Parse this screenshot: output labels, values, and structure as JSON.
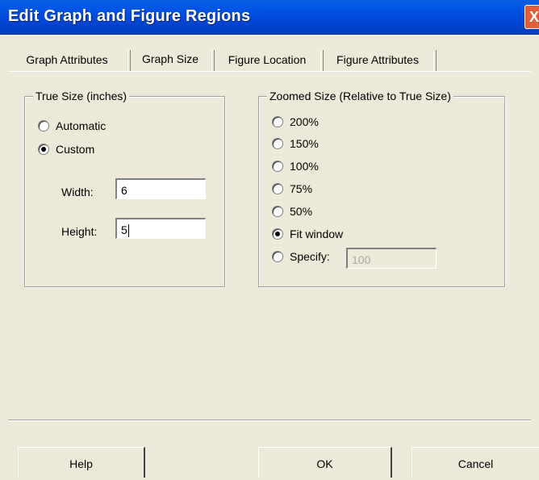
{
  "window": {
    "title": "Edit Graph and Figure Regions",
    "close_glyph": "X"
  },
  "tabs": [
    {
      "label": "Graph Attributes",
      "active": false
    },
    {
      "label": "Graph Size",
      "active": true
    },
    {
      "label": "Figure Location",
      "active": false
    },
    {
      "label": "Figure Attributes",
      "active": false
    }
  ],
  "true_size": {
    "title": "True Size (inches)",
    "options": [
      {
        "label": "Automatic",
        "checked": false
      },
      {
        "label": "Custom",
        "checked": true
      }
    ],
    "width_label": "Width:",
    "width_value": "6",
    "height_label": "Height:",
    "height_value": "5"
  },
  "zoomed_size": {
    "title": "Zoomed Size (Relative to True Size)",
    "options": [
      {
        "label": "200%",
        "checked": false
      },
      {
        "label": "150%",
        "checked": false
      },
      {
        "label": "100%",
        "checked": false
      },
      {
        "label": "75%",
        "checked": false
      },
      {
        "label": "50%",
        "checked": false
      },
      {
        "label": "Fit window",
        "checked": true
      },
      {
        "label": "Specify:",
        "checked": false
      }
    ],
    "specify_value": "100"
  },
  "buttons": {
    "help": "Help",
    "ok": "OK",
    "cancel": "Cancel"
  }
}
